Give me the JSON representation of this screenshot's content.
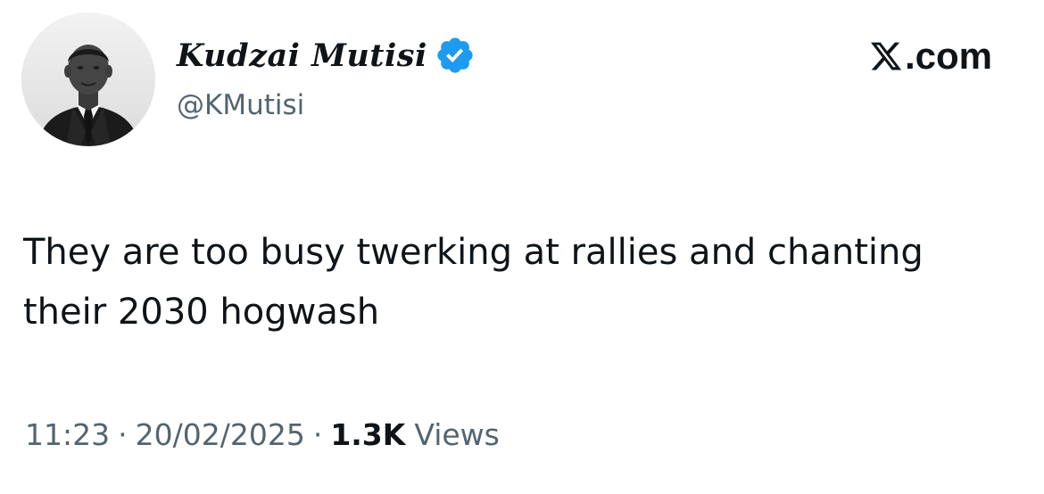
{
  "tweet": {
    "author": {
      "display_name": "Kudzai Mutisi",
      "handle": "@KMutisi",
      "verified": true,
      "avatar_icon": "profile-photo",
      "verified_icon": "verified-badge-icon",
      "verified_color": "#1d9bf0"
    },
    "brand": {
      "logo_icon": "x-logo-icon",
      "text": ".com"
    },
    "text": "They are too busy twerking at rallies and chanting their 2030 hogwash",
    "meta": {
      "time": "11:23",
      "separator": "·",
      "date": "20/02/2025",
      "views_count": "1.3K",
      "views_label": "Views"
    }
  },
  "colors": {
    "text_primary": "#0f1419",
    "text_secondary": "#536471",
    "background": "#ffffff",
    "verified_blue": "#1d9bf0"
  }
}
